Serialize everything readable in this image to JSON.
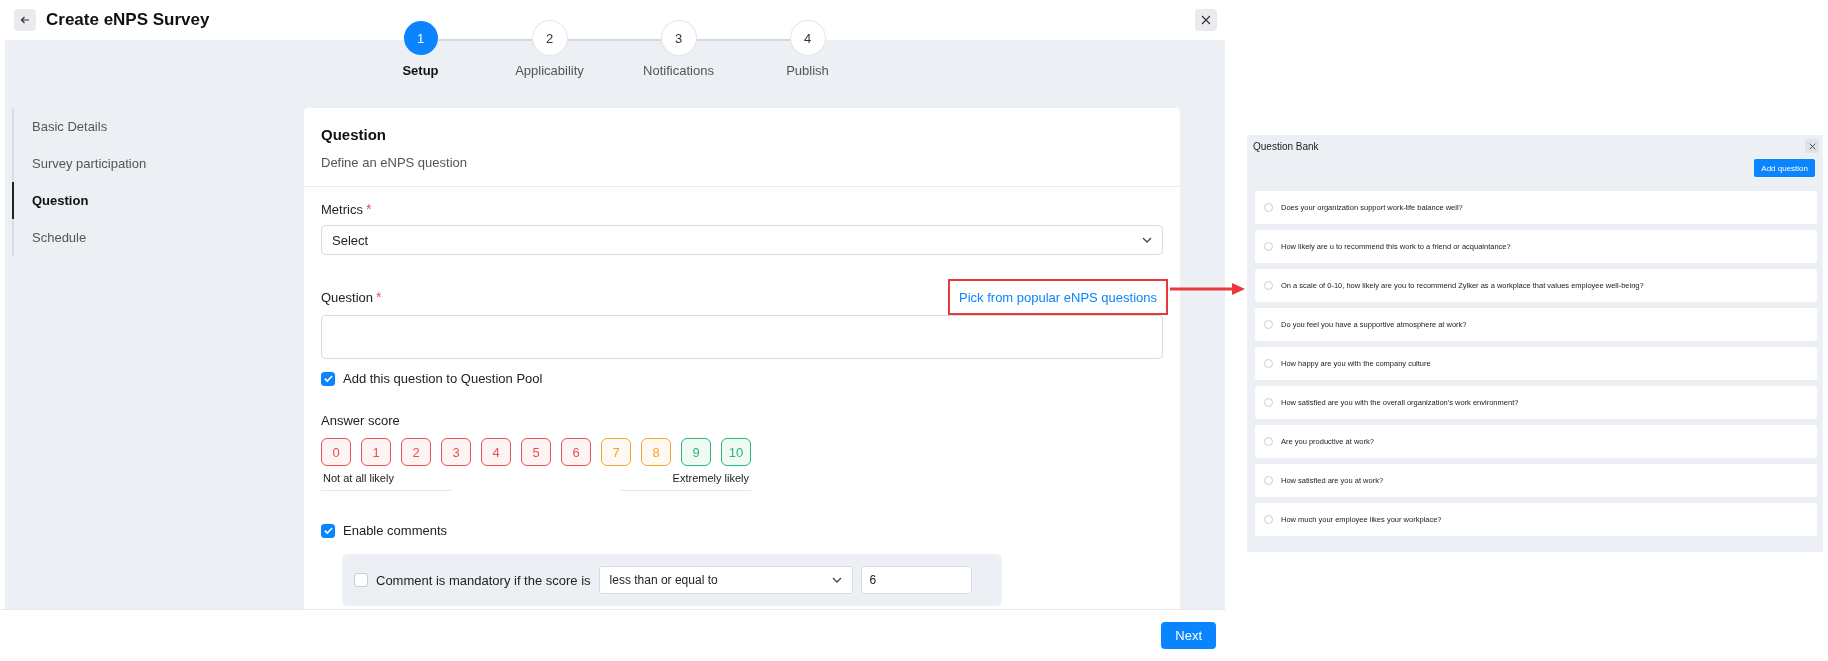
{
  "header": {
    "title": "Create eNPS Survey"
  },
  "steps": [
    {
      "number": "1",
      "label": "Setup",
      "selected": true
    },
    {
      "number": "2",
      "label": "Applicability",
      "selected": false
    },
    {
      "number": "3",
      "label": "Notifications",
      "selected": false
    },
    {
      "number": "4",
      "label": "Publish",
      "selected": false
    }
  ],
  "sidebar": {
    "items": [
      {
        "label": "Basic Details",
        "selected": false
      },
      {
        "label": "Survey participation",
        "selected": false
      },
      {
        "label": "Question",
        "selected": true
      },
      {
        "label": "Schedule",
        "selected": false
      }
    ]
  },
  "question_card": {
    "title": "Question",
    "subtitle": "Define an eNPS question",
    "metrics": {
      "label": "Metrics",
      "required_mark": "*",
      "value": "Select"
    },
    "question": {
      "label": "Question",
      "required_mark": "*",
      "link": "Pick from popular eNPS questions"
    },
    "add_to_pool": {
      "label": "Add this question to Question Pool",
      "checked": true
    },
    "answer_score": {
      "label": "Answer score",
      "low_label": "Not at all likely",
      "high_label": "Extremely likely",
      "scores": [
        {
          "label": "0",
          "color": "#e8505b"
        },
        {
          "label": "1",
          "color": "#e8505b"
        },
        {
          "label": "2",
          "color": "#e8505b"
        },
        {
          "label": "3",
          "color": "#e8505b"
        },
        {
          "label": "4",
          "color": "#e8505b"
        },
        {
          "label": "5",
          "color": "#e8505b"
        },
        {
          "label": "6",
          "color": "#e8505b"
        },
        {
          "label": "7",
          "color": "#f0a43a"
        },
        {
          "label": "8",
          "color": "#f0a43a"
        },
        {
          "label": "9",
          "color": "#2bb673"
        },
        {
          "label": "10",
          "color": "#2bb673"
        }
      ]
    },
    "enable_comments": {
      "label": "Enable comments",
      "checked": true
    },
    "mandatory": {
      "label": "Comment is mandatory if the score is",
      "checked": false,
      "condition": "less than or equal to",
      "score": "6"
    }
  },
  "footer": {
    "next": "Next"
  },
  "question_bank": {
    "title": "Question Bank",
    "add_button": "Add question",
    "questions": [
      {
        "text": "Does your organization support work-life balance well?",
        "selected": false
      },
      {
        "text": "How likely are u to recommend this work to a friend or acquaintance?",
        "selected": false
      },
      {
        "text": "On a scale of 0-10, how likely are you to recommend Zylker as a workplace that values employee well-being?",
        "selected": false
      },
      {
        "text": "Do you feel you have a supportive atmosphere at work?",
        "selected": false
      },
      {
        "text": "How happy are you with the company culture",
        "selected": false
      },
      {
        "text": "How satisfied are you with the overall organization's work environment?",
        "selected": false
      },
      {
        "text": "Are you productive at work?",
        "selected": false
      },
      {
        "text": "How satisfied are you at work?",
        "selected": false
      },
      {
        "text": "How much your employee likes your workplace?",
        "selected": false
      }
    ]
  }
}
